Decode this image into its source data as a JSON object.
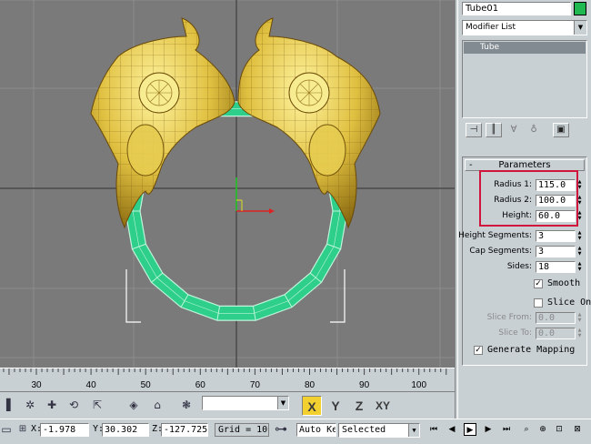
{
  "panel": {
    "object_name": "Tube01",
    "object_color": "#20b850",
    "modifier_list": "Modifier List",
    "stack_items": [
      "Tube"
    ],
    "rollout_title": "Parameters",
    "rollout_toggle": "-",
    "params": [
      {
        "label": "Radius 1:",
        "value": "115.0"
      },
      {
        "label": "Radius 2:",
        "value": "100.0"
      },
      {
        "label": "Height:",
        "value": "60.0"
      },
      {
        "label": "Height Segments:",
        "value": "3"
      },
      {
        "label": "Cap Segments:",
        "value": "3"
      },
      {
        "label": "Sides:",
        "value": "18"
      }
    ],
    "smooth": {
      "label": "Smooth",
      "checked": true
    },
    "slice_on": {
      "label": "Slice On",
      "checked": false
    },
    "slice_from": {
      "label": "Slice From:",
      "value": "0.0"
    },
    "slice_to": {
      "label": "Slice To:",
      "value": "0.0"
    },
    "gen_mapping": {
      "label": "Generate Mapping",
      "checked": true
    },
    "highlight_color": "#d0143c"
  },
  "timeline": {
    "ticks": [
      "30",
      "40",
      "50",
      "60",
      "70",
      "80",
      "90",
      "100"
    ]
  },
  "toolbar": {
    "axes": [
      "X",
      "Y",
      "Z",
      "XY"
    ],
    "active_axis": "X"
  },
  "status": {
    "x_label": "X:",
    "x_value": "-1.978",
    "y_label": "Y:",
    "y_value": "30.302",
    "z_label": "Z:",
    "z_value": "-127.725",
    "grid": "Grid = 10",
    "autokey": "Auto Key",
    "selection_mode": "Selected"
  },
  "colors": {
    "viewport_bg": "#7a7a7a",
    "tube": "#2ecf8a",
    "mask": "#d8c040"
  }
}
